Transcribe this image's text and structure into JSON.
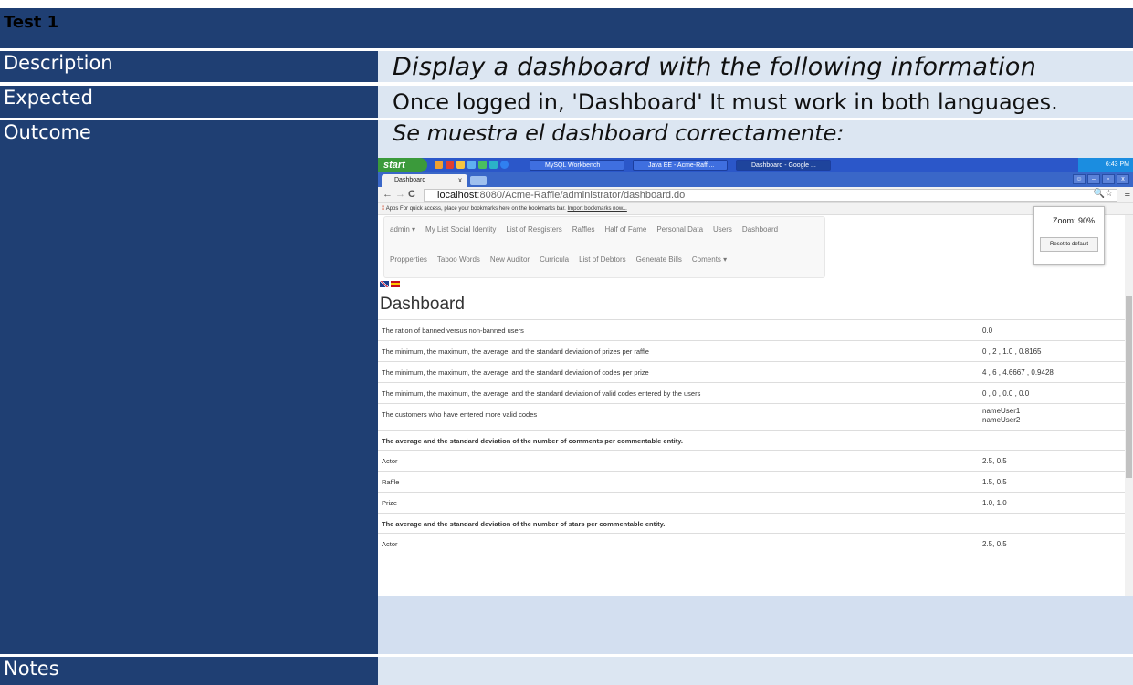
{
  "header": {
    "title": "Test 1"
  },
  "rows": {
    "description": {
      "label": "Description",
      "value": "Display a dashboard with the following information"
    },
    "expected": {
      "label": "Expected",
      "value": "Once logged in, 'Dashboard' It must work in both languages."
    },
    "outcome": {
      "label": "Outcome",
      "value": "Se muestra el dashboard correctamente:"
    },
    "notes": {
      "label": "Notes",
      "value": ""
    }
  },
  "screenshot": {
    "taskbar": {
      "start": "start",
      "tasks": [
        "MySQL Workbench",
        "Java EE - Acme-Raffl...",
        "Dashboard - Google ..."
      ],
      "clock": "6:43 PM"
    },
    "browser": {
      "tab_title": "Dashboard",
      "tab_close": "x",
      "url_host": "localhost",
      "url_path": ":8080/Acme-Raffle/administrator/dashboard.do",
      "bookmarks_apps": "Apps",
      "bookmarks_text": "For quick access, place your bookmarks here on the bookmarks bar.",
      "bookmarks_link": "Import bookmarks now...",
      "zoom_label": "Zoom: 90%",
      "reset_label": "Reset to default"
    },
    "nav": {
      "row1": [
        "admin ▾",
        "My List Social Identity",
        "List of Resgisters",
        "Raffles",
        "Half of Fame",
        "Personal Data",
        "Users",
        "Dashboard"
      ],
      "row2": [
        "Propperties",
        "Taboo Words",
        "New Auditor",
        "Curricula",
        "List of Debtors",
        "Generate Bills",
        "Coments ▾"
      ]
    },
    "dashboard": {
      "title": "Dashboard",
      "rows": [
        {
          "q": "The ration of banned versus non-banned users",
          "a": "0.0"
        },
        {
          "q": "The minimum, the maximum, the average, and the standard deviation of prizes per raffle",
          "a": "0 , 2 , 1.0 , 0.8165"
        },
        {
          "q": "The minimum, the maximum, the average, and the standard deviation of codes per prize",
          "a": "4 , 6 , 4.6667 , 0.9428"
        },
        {
          "q": "The minimum, the maximum, the average, and the standard deviation of valid codes entered by the users",
          "a": "0 , 0 , 0.0 , 0.0"
        },
        {
          "q": "The customers who have entered more valid codes",
          "a": "nameUser1",
          "a2": "nameUser2"
        },
        {
          "q": "The average and the standard deviation of the number of comments per commentable entity.",
          "a": ""
        },
        {
          "q": "Actor",
          "a": "2.5, 0.5"
        },
        {
          "q": "Raffle",
          "a": "1.5, 0.5"
        },
        {
          "q": "Prize",
          "a": "1.0, 1.0"
        },
        {
          "q": "The average and the standard deviation of the number of stars per commentable entity.",
          "a": ""
        },
        {
          "q": "Actor",
          "a": "2.5, 0.5"
        }
      ]
    }
  }
}
